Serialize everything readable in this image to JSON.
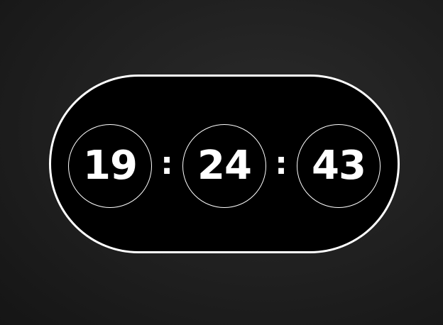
{
  "clock": {
    "hours": "19",
    "minutes": "24",
    "seconds": "43",
    "separator": ":"
  },
  "colors": {
    "background": "#1f1f1f",
    "pill_fill": "#000000",
    "outline": "#ffffff",
    "text": "#ffffff"
  }
}
